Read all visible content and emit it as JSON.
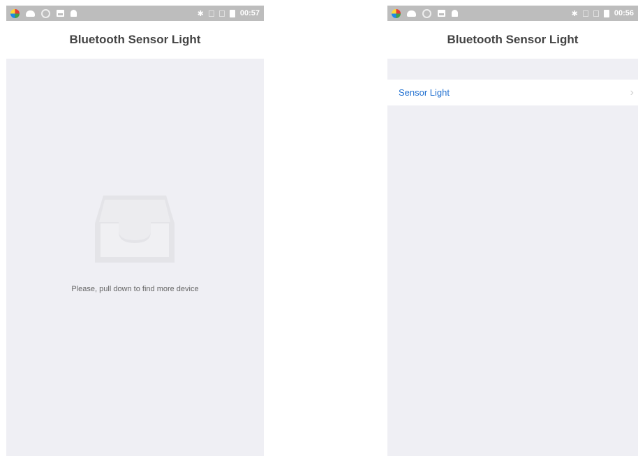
{
  "left_screen": {
    "status_bar": {
      "time": "00:57",
      "bluetooth_glyph": "✱"
    },
    "nav": {
      "title": "Bluetooth Sensor Light"
    },
    "empty_state": {
      "icon": "inbox-tray-icon",
      "message": "Please, pull down to find more device"
    }
  },
  "right_screen": {
    "status_bar": {
      "time": "00:56",
      "bluetooth_glyph": "✱"
    },
    "nav": {
      "title": "Bluetooth Sensor Light"
    },
    "devices": [
      {
        "label": "Sensor Light",
        "chevron": "›"
      }
    ]
  },
  "colors": {
    "status_bar": "#bdbdbd",
    "content_background": "#efeff4",
    "link_blue": "#1f6fd0",
    "title_text": "#444444"
  }
}
